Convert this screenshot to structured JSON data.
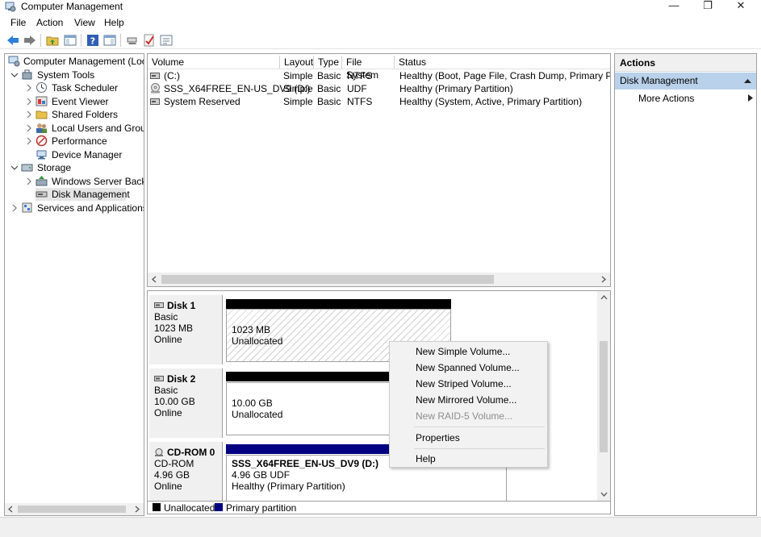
{
  "window": {
    "title": "Computer Management"
  },
  "menu": [
    "File",
    "Action",
    "View",
    "Help"
  ],
  "tree": {
    "root": "Computer Management (Local",
    "system_tools": "System Tools",
    "system_tools_children": [
      "Task Scheduler",
      "Event Viewer",
      "Shared Folders",
      "Local Users and Groups",
      "Performance",
      "Device Manager"
    ],
    "storage": "Storage",
    "storage_children": [
      "Windows Server Backup",
      "Disk Management"
    ],
    "services": "Services and Applications"
  },
  "volumes": {
    "headers": [
      "Volume",
      "Layout",
      "Type",
      "File System",
      "Status"
    ],
    "rows": [
      [
        "(C:)",
        "Simple",
        "Basic",
        "NTFS",
        "Healthy (Boot, Page File, Crash Dump, Primary Partitio"
      ],
      [
        "SSS_X64FREE_EN-US_DV9 (D:)",
        "Simple",
        "Basic",
        "UDF",
        "Healthy (Primary Partition)"
      ],
      [
        "System Reserved",
        "Simple",
        "Basic",
        "NTFS",
        "Healthy (System, Active, Primary Partition)"
      ]
    ]
  },
  "disks": [
    {
      "name": "Disk 1",
      "type": "Basic",
      "size": "1023 MB",
      "state": "Online",
      "part_size": "1023 MB",
      "part_label": "Unallocated"
    },
    {
      "name": "Disk 2",
      "type": "Basic",
      "size": "10.00 GB",
      "state": "Online",
      "part_size": "10.00 GB",
      "part_label": "Unallocated"
    },
    {
      "name": "CD-ROM 0",
      "type": "CD-ROM",
      "size": "4.96 GB",
      "state": "Online",
      "part_name": "SSS_X64FREE_EN-US_DV9  (D:)",
      "part_size": "4.96 GB UDF",
      "part_label": "Healthy (Primary Partition)"
    }
  ],
  "legend": [
    "Unallocated",
    "Primary partition"
  ],
  "actions": {
    "header": "Actions",
    "section": "Disk Management",
    "more": "More Actions"
  },
  "context_menu": {
    "items": [
      "New Simple Volume...",
      "New Spanned Volume...",
      "New Striped Volume...",
      "New Mirrored Volume...",
      "New RAID-5 Volume..."
    ],
    "properties": "Properties",
    "help": "Help"
  },
  "colors": {
    "unallocated": "#000000",
    "primary": "#000080",
    "selection": "#b9d1ea"
  }
}
